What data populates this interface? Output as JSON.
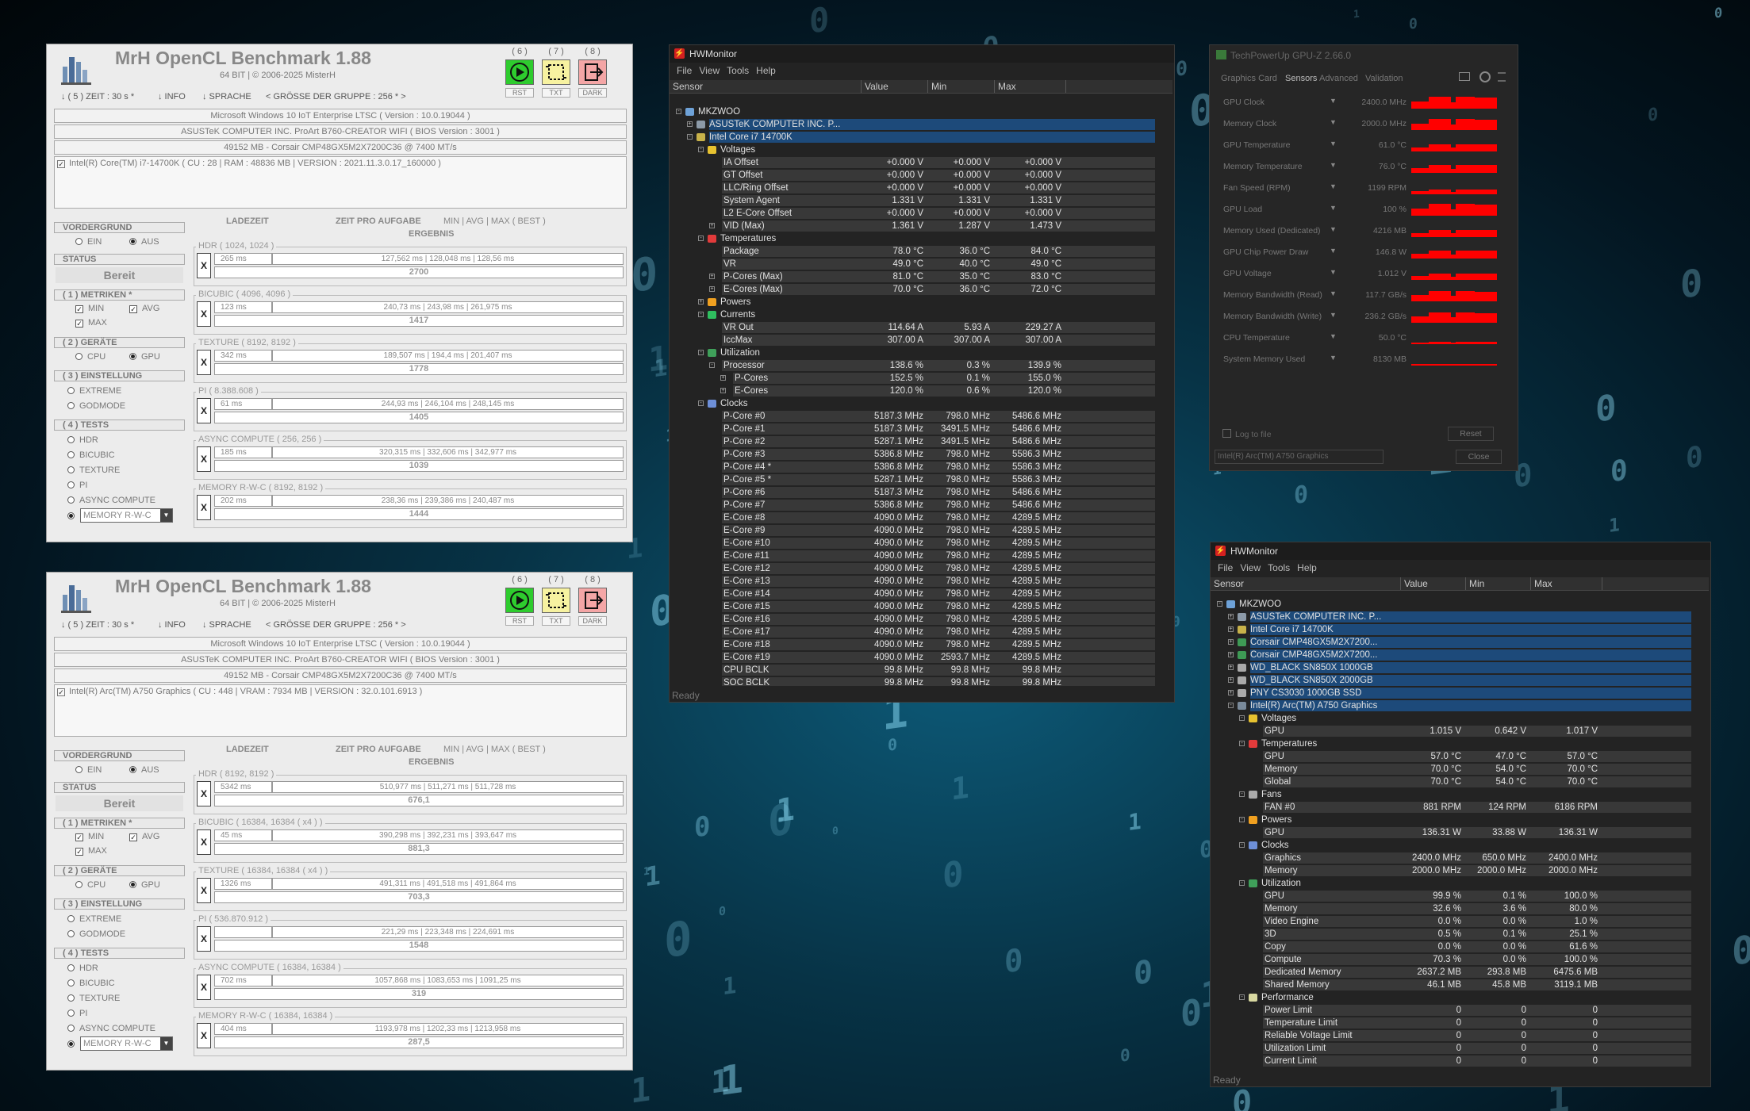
{
  "bench": {
    "title": "MrH OpenCL Benchmark 1.88",
    "subtitle": "64 BIT | ©  2006-2025 MisterH",
    "menu": [
      "↓ ( 5 ) ZEIT : 30 s *",
      "↓ INFO",
      "↓ SPRACHE",
      "< GRÖSSE DER GRUPPE : 256 * >"
    ],
    "toolbar": [
      {
        "num": "( 6 )",
        "label": "RST",
        "icon": "play-icon",
        "color": "#2ecc2e"
      },
      {
        "num": "( 7 )",
        "label": "TXT",
        "icon": "crop-icon",
        "color": "#f7f2a0"
      },
      {
        "num": "( 8 )",
        "label": "DARK",
        "icon": "exit-icon",
        "color": "#f4a6a6"
      }
    ],
    "os": "Microsoft Windows 10 IoT Enterprise LTSC ( Version : 10.0.19044 )",
    "board": "ASUSTeK COMPUTER INC. ProArt B760-CREATOR WIFI ( BIOS Version : 3001 )",
    "memory": "49152 MB - Corsair CMP48GX5M2X7200C36  @ 7400 MT/s",
    "left": {
      "vordergrund": "VORDERGRUND",
      "ein": "EIN",
      "aus": "AUS",
      "status": "STATUS",
      "status_value": "Bereit",
      "metriken": "( 1 ) METRIKEN *",
      "min": "MIN",
      "avg": "AVG",
      "max": "MAX",
      "geraete": "( 2 ) GERÄTE",
      "cpu": "CPU",
      "gpu": "GPU",
      "einstellung": "( 3 ) EINSTELLUNG",
      "extreme": "EXTREME",
      "godmode": "GODMODE",
      "tests": "( 4 ) TESTS",
      "test_names": [
        "HDR",
        "BICUBIC",
        "TEXTURE",
        "PI",
        "ASYNC COMPUTE"
      ],
      "mem_select": "MEMORY R-W-C"
    },
    "cols": {
      "ladezeit": "LADEZEIT",
      "zeit": "ZEIT PRO AUFGABE",
      "minavg": "MIN | AVG | MAX ( BEST )",
      "ergebnis": "ERGEBNIS"
    },
    "x_label": "X"
  },
  "bench1": {
    "device": "Intel(R) Core(TM) i7-14700K ( CU : 28 | RAM : 48836 MB | VERSION : 2021.11.3.0.17_160000 )",
    "tests": [
      {
        "name": "HDR ( 1024, 1024 )",
        "load": "265 ms",
        "times": "127,562 ms | 128,048 ms | 128,56 ms",
        "result": "2700"
      },
      {
        "name": "BICUBIC ( 4096, 4096 )",
        "load": "123 ms",
        "times": "240,73 ms | 243,98 ms | 261,975 ms",
        "result": "1417"
      },
      {
        "name": "TEXTURE ( 8192, 8192 )",
        "load": "342 ms",
        "times": "189,507 ms | 194,4 ms | 201,407 ms",
        "result": "1778"
      },
      {
        "name": "PI ( 8.388.608 )",
        "load": "61 ms",
        "times": "244,93 ms | 246,104 ms | 248,145 ms",
        "result": "1405"
      },
      {
        "name": "ASYNC COMPUTE ( 256, 256 )",
        "load": "185 ms",
        "times": "320,315 ms | 332,606 ms | 342,977 ms",
        "result": "1039"
      },
      {
        "name": "MEMORY R-W-C ( 8192, 8192 )",
        "load": "202 ms",
        "times": "238,36 ms | 239,386 ms | 240,487 ms",
        "result": "1444"
      }
    ]
  },
  "bench2": {
    "device": "Intel(R) Arc(TM) A750 Graphics ( CU : 448 | VRAM : 7934 MB | VERSION : 32.0.101.6913 )",
    "tests": [
      {
        "name": "HDR ( 8192, 8192 )",
        "load": "5342 ms",
        "times": "510,977 ms | 511,271 ms | 511,728 ms",
        "result": "676,1"
      },
      {
        "name": "BICUBIC ( 16384, 16384 ( x4 ) )",
        "load": "45 ms",
        "times": "390,298 ms | 392,231 ms | 393,647 ms",
        "result": "881,3"
      },
      {
        "name": "TEXTURE ( 16384, 16384 ( x4 ) )",
        "load": "1326 ms",
        "times": "491,311 ms | 491,518 ms | 491,864 ms",
        "result": "703,3"
      },
      {
        "name": "PI ( 536.870.912 )",
        "load": "",
        "times": "221,29 ms | 223,348 ms | 224,691 ms",
        "result": "1548"
      },
      {
        "name": "ASYNC COMPUTE ( 16384, 16384 )",
        "load": "702 ms",
        "times": "1057,868 ms | 1083,653 ms | 1091,25 ms",
        "result": "319"
      },
      {
        "name": "MEMORY R-W-C ( 16384, 16384 )",
        "load": "404 ms",
        "times": "1193,978 ms | 1202,33 ms | 1213,958 ms",
        "result": "287,5"
      }
    ]
  },
  "hwm_common": {
    "title": "HWMonitor",
    "menu": [
      "File",
      "View",
      "Tools",
      "Help"
    ],
    "cols": [
      "Sensor",
      "Value",
      "Min",
      "Max"
    ],
    "status": "Ready"
  },
  "hwm1_rows": [
    {
      "n": "MKZWOO",
      "lvl": 0,
      "ic": "pc",
      "ex": "-"
    },
    {
      "n": "ASUSTeK COMPUTER INC. P...",
      "lvl": 1,
      "ic": "board",
      "ex": "+",
      "hl": true
    },
    {
      "n": "Intel Core i7 14700K",
      "lvl": 1,
      "ic": "chip",
      "ex": "-",
      "hl": true
    },
    {
      "n": "Voltages",
      "lvl": 2,
      "ic": "volt",
      "ex": "-"
    },
    {
      "n": "IA Offset",
      "lvl": 3,
      "v": [
        "+0.000 V",
        "+0.000 V",
        "+0.000 V"
      ]
    },
    {
      "n": "GT Offset",
      "lvl": 3,
      "v": [
        "+0.000 V",
        "+0.000 V",
        "+0.000 V"
      ]
    },
    {
      "n": "LLC/Ring Offset",
      "lvl": 3,
      "v": [
        "+0.000 V",
        "+0.000 V",
        "+0.000 V"
      ]
    },
    {
      "n": "System Agent",
      "lvl": 3,
      "v": [
        "1.331 V",
        "1.331 V",
        "1.331 V"
      ]
    },
    {
      "n": "L2 E-Core Offset",
      "lvl": 3,
      "v": [
        "+0.000 V",
        "+0.000 V",
        "+0.000 V"
      ]
    },
    {
      "n": "VID (Max)",
      "lvl": 3,
      "ex": "+",
      "v": [
        "1.361 V",
        "1.287 V",
        "1.473 V"
      ]
    },
    {
      "n": "Temperatures",
      "lvl": 2,
      "ic": "temp",
      "ex": "-"
    },
    {
      "n": "Package",
      "lvl": 3,
      "v": [
        "78.0 °C",
        "36.0 °C",
        "84.0 °C"
      ]
    },
    {
      "n": "VR",
      "lvl": 3,
      "v": [
        "49.0 °C",
        "40.0 °C",
        "49.0 °C"
      ]
    },
    {
      "n": "P-Cores (Max)",
      "lvl": 3,
      "ex": "+",
      "v": [
        "81.0 °C",
        "35.0 °C",
        "83.0 °C"
      ]
    },
    {
      "n": "E-Cores (Max)",
      "lvl": 3,
      "ex": "+",
      "v": [
        "70.0 °C",
        "36.0 °C",
        "72.0 °C"
      ]
    },
    {
      "n": "Powers",
      "lvl": 2,
      "ic": "power",
      "ex": "+"
    },
    {
      "n": "Currents",
      "lvl": 2,
      "ic": "curr",
      "ex": "-"
    },
    {
      "n": "VR Out",
      "lvl": 3,
      "v": [
        "114.64 A",
        "5.93 A",
        "229.27 A"
      ]
    },
    {
      "n": "IccMax",
      "lvl": 3,
      "v": [
        "307.00 A",
        "307.00 A",
        "307.00 A"
      ]
    },
    {
      "n": "Utilization",
      "lvl": 2,
      "ic": "util",
      "ex": "-"
    },
    {
      "n": "Processor",
      "lvl": 3,
      "ex": "-",
      "v": [
        "138.6 %",
        "0.3 %",
        "139.9 %"
      ]
    },
    {
      "n": "P-Cores",
      "lvl": 4,
      "ex": "+",
      "v": [
        "152.5 %",
        "0.1 %",
        "155.0 %"
      ]
    },
    {
      "n": "E-Cores",
      "lvl": 4,
      "ex": "+",
      "v": [
        "120.0 %",
        "0.6 %",
        "120.0 %"
      ]
    },
    {
      "n": "Clocks",
      "lvl": 2,
      "ic": "clock",
      "ex": "-"
    },
    {
      "n": "P-Core #0",
      "lvl": 3,
      "v": [
        "5187.3 MHz",
        "798.0 MHz",
        "5486.6 MHz"
      ]
    },
    {
      "n": "P-Core #1",
      "lvl": 3,
      "v": [
        "5187.3 MHz",
        "3491.5 MHz",
        "5486.6 MHz"
      ]
    },
    {
      "n": "P-Core #2",
      "lvl": 3,
      "v": [
        "5287.1 MHz",
        "3491.5 MHz",
        "5486.6 MHz"
      ]
    },
    {
      "n": "P-Core #3",
      "lvl": 3,
      "v": [
        "5386.8 MHz",
        "798.0 MHz",
        "5586.3 MHz"
      ]
    },
    {
      "n": "P-Core #4 *",
      "lvl": 3,
      "v": [
        "5386.8 MHz",
        "798.0 MHz",
        "5586.3 MHz"
      ]
    },
    {
      "n": "P-Core #5 *",
      "lvl": 3,
      "v": [
        "5287.1 MHz",
        "798.0 MHz",
        "5586.3 MHz"
      ]
    },
    {
      "n": "P-Core #6",
      "lvl": 3,
      "v": [
        "5187.3 MHz",
        "798.0 MHz",
        "5486.6 MHz"
      ]
    },
    {
      "n": "P-Core #7",
      "lvl": 3,
      "v": [
        "5386.8 MHz",
        "798.0 MHz",
        "5486.6 MHz"
      ]
    },
    {
      "n": "E-Core #8",
      "lvl": 3,
      "v": [
        "4090.0 MHz",
        "798.0 MHz",
        "4289.5 MHz"
      ]
    },
    {
      "n": "E-Core #9",
      "lvl": 3,
      "v": [
        "4090.0 MHz",
        "798.0 MHz",
        "4289.5 MHz"
      ]
    },
    {
      "n": "E-Core #10",
      "lvl": 3,
      "v": [
        "4090.0 MHz",
        "798.0 MHz",
        "4289.5 MHz"
      ]
    },
    {
      "n": "E-Core #11",
      "lvl": 3,
      "v": [
        "4090.0 MHz",
        "798.0 MHz",
        "4289.5 MHz"
      ]
    },
    {
      "n": "E-Core #12",
      "lvl": 3,
      "v": [
        "4090.0 MHz",
        "798.0 MHz",
        "4289.5 MHz"
      ]
    },
    {
      "n": "E-Core #13",
      "lvl": 3,
      "v": [
        "4090.0 MHz",
        "798.0 MHz",
        "4289.5 MHz"
      ]
    },
    {
      "n": "E-Core #14",
      "lvl": 3,
      "v": [
        "4090.0 MHz",
        "798.0 MHz",
        "4289.5 MHz"
      ]
    },
    {
      "n": "E-Core #15",
      "lvl": 3,
      "v": [
        "4090.0 MHz",
        "798.0 MHz",
        "4289.5 MHz"
      ]
    },
    {
      "n": "E-Core #16",
      "lvl": 3,
      "v": [
        "4090.0 MHz",
        "798.0 MHz",
        "4289.5 MHz"
      ]
    },
    {
      "n": "E-Core #17",
      "lvl": 3,
      "v": [
        "4090.0 MHz",
        "798.0 MHz",
        "4289.5 MHz"
      ]
    },
    {
      "n": "E-Core #18",
      "lvl": 3,
      "v": [
        "4090.0 MHz",
        "798.0 MHz",
        "4289.5 MHz"
      ]
    },
    {
      "n": "E-Core #19",
      "lvl": 3,
      "v": [
        "4090.0 MHz",
        "2593.7 MHz",
        "4289.5 MHz"
      ]
    },
    {
      "n": "CPU BCLK",
      "lvl": 3,
      "v": [
        "99.8 MHz",
        "99.8 MHz",
        "99.8 MHz"
      ]
    },
    {
      "n": "SOC BCLK",
      "lvl": 3,
      "v": [
        "99.8 MHz",
        "99.8 MHz",
        "99.8 MHz"
      ]
    }
  ],
  "hwm2_rows": [
    {
      "n": "MKZWOO",
      "lvl": 0,
      "ic": "pc",
      "ex": "-"
    },
    {
      "n": "ASUSTeK COMPUTER INC. P...",
      "lvl": 1,
      "ic": "board",
      "ex": "+",
      "hl": true
    },
    {
      "n": "Intel Core i7 14700K",
      "lvl": 1,
      "ic": "chip",
      "ex": "+",
      "hl": true
    },
    {
      "n": "Corsair CMP48GX5M2X7200...",
      "lvl": 1,
      "ic": "ram",
      "ex": "+",
      "hl": true
    },
    {
      "n": "Corsair CMP48GX5M2X7200...",
      "lvl": 1,
      "ic": "ram",
      "ex": "+",
      "hl": true
    },
    {
      "n": "WD_BLACK SN850X 1000GB",
      "lvl": 1,
      "ic": "disk",
      "ex": "+",
      "hl": true
    },
    {
      "n": "WD_BLACK SN850X 2000GB",
      "lvl": 1,
      "ic": "disk",
      "ex": "+",
      "hl": true
    },
    {
      "n": "PNY CS3030 1000GB SSD",
      "lvl": 1,
      "ic": "disk",
      "ex": "+",
      "hl": true
    },
    {
      "n": "Intel(R) Arc(TM) A750 Graphics",
      "lvl": 1,
      "ic": "gpu",
      "ex": "-",
      "hl": true
    },
    {
      "n": "Voltages",
      "lvl": 2,
      "ic": "volt",
      "ex": "-"
    },
    {
      "n": "GPU",
      "lvl": 3,
      "v": [
        "1.015 V",
        "0.642 V",
        "1.017 V"
      ]
    },
    {
      "n": "Temperatures",
      "lvl": 2,
      "ic": "temp",
      "ex": "-"
    },
    {
      "n": "GPU",
      "lvl": 3,
      "v": [
        "57.0 °C",
        "47.0 °C",
        "57.0 °C"
      ]
    },
    {
      "n": "Memory",
      "lvl": 3,
      "v": [
        "70.0 °C",
        "54.0 °C",
        "70.0 °C"
      ]
    },
    {
      "n": "Global",
      "lvl": 3,
      "v": [
        "70.0 °C",
        "54.0 °C",
        "70.0 °C"
      ]
    },
    {
      "n": "Fans",
      "lvl": 2,
      "ic": "fan",
      "ex": "-"
    },
    {
      "n": "FAN #0",
      "lvl": 3,
      "v": [
        "881 RPM",
        "124 RPM",
        "6186 RPM"
      ]
    },
    {
      "n": "Powers",
      "lvl": 2,
      "ic": "power",
      "ex": "-"
    },
    {
      "n": "GPU",
      "lvl": 3,
      "v": [
        "136.31 W",
        "33.88 W",
        "136.31 W"
      ]
    },
    {
      "n": "Clocks",
      "lvl": 2,
      "ic": "clock",
      "ex": "-"
    },
    {
      "n": "Graphics",
      "lvl": 3,
      "v": [
        "2400.0 MHz",
        "650.0 MHz",
        "2400.0 MHz"
      ]
    },
    {
      "n": "Memory",
      "lvl": 3,
      "v": [
        "2000.0 MHz",
        "2000.0 MHz",
        "2000.0 MHz"
      ]
    },
    {
      "n": "Utilization",
      "lvl": 2,
      "ic": "util",
      "ex": "-"
    },
    {
      "n": "GPU",
      "lvl": 3,
      "v": [
        "99.9 %",
        "0.1 %",
        "100.0 %"
      ]
    },
    {
      "n": "Memory",
      "lvl": 3,
      "v": [
        "32.6 %",
        "3.6 %",
        "80.0 %"
      ]
    },
    {
      "n": "Video Engine",
      "lvl": 3,
      "v": [
        "0.0 %",
        "0.0 %",
        "1.0 %"
      ]
    },
    {
      "n": "3D",
      "lvl": 3,
      "v": [
        "0.5 %",
        "0.1 %",
        "25.1 %"
      ]
    },
    {
      "n": "Copy",
      "lvl": 3,
      "v": [
        "0.0 %",
        "0.0 %",
        "61.6 %"
      ]
    },
    {
      "n": "Compute",
      "lvl": 3,
      "v": [
        "70.3 %",
        "0.0 %",
        "100.0 %"
      ]
    },
    {
      "n": "Dedicated Memory",
      "lvl": 3,
      "v": [
        "2637.2 MB",
        "293.8 MB",
        "6475.6 MB"
      ]
    },
    {
      "n": "Shared Memory",
      "lvl": 3,
      "v": [
        "46.1 MB",
        "45.8 MB",
        "3119.1 MB"
      ]
    },
    {
      "n": "Performance",
      "lvl": 2,
      "ic": "perf",
      "ex": "-"
    },
    {
      "n": "Power Limit",
      "lvl": 3,
      "v": [
        "0",
        "0",
        "0"
      ]
    },
    {
      "n": "Temperature Limit",
      "lvl": 3,
      "v": [
        "0",
        "0",
        "0"
      ]
    },
    {
      "n": "Reliable Voltage Limit",
      "lvl": 3,
      "v": [
        "0",
        "0",
        "0"
      ]
    },
    {
      "n": "Utilization Limit",
      "lvl": 3,
      "v": [
        "0",
        "0",
        "0"
      ]
    },
    {
      "n": "Current Limit",
      "lvl": 3,
      "v": [
        "0",
        "0",
        "0"
      ]
    }
  ],
  "gpuz": {
    "title": "TechPowerUp GPU-Z 2.66.0",
    "tabs": [
      "Graphics Card",
      "Sensors",
      "Advanced",
      "Validation"
    ],
    "sensors": [
      {
        "name": "GPU Clock",
        "value": "2400.0 MHz",
        "level": 0.92
      },
      {
        "name": "Memory Clock",
        "value": "2000.0 MHz",
        "level": 0.9
      },
      {
        "name": "GPU Temperature",
        "value": "61.0 °C",
        "level": 0.55
      },
      {
        "name": "Memory Temperature",
        "value": "76.0 °C",
        "level": 0.6
      },
      {
        "name": "Fan Speed (RPM)",
        "value": "1199 RPM",
        "level": 0.4
      },
      {
        "name": "GPU Load",
        "value": "100 %",
        "level": 0.95
      },
      {
        "name": "Memory Used (Dedicated)",
        "value": "4216 MB",
        "level": 0.55
      },
      {
        "name": "GPU Chip Power Draw",
        "value": "146.8 W",
        "level": 0.6
      },
      {
        "name": "GPU Voltage",
        "value": "1.012 V",
        "level": 0.5
      },
      {
        "name": "Memory Bandwidth (Read)",
        "value": "117.7 GB/s",
        "level": 0.8
      },
      {
        "name": "Memory Bandwidth (Write)",
        "value": "236.2 GB/s",
        "level": 0.8
      },
      {
        "name": "CPU Temperature",
        "value": "50.0 °C",
        "level": 0.2
      },
      {
        "name": "System Memory Used",
        "value": "8130 MB",
        "level": 0.15
      }
    ],
    "log": "Log to file",
    "reset": "Reset",
    "device": "Intel(R) Arc(TM) A750 Graphics",
    "close": "Close"
  }
}
